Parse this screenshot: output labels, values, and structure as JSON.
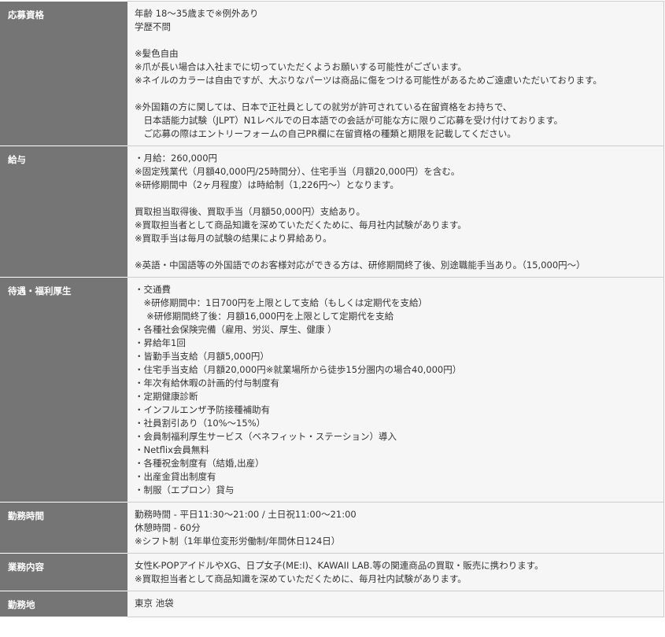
{
  "rows": [
    {
      "label": "応募資格",
      "lines": [
        "年齢 18～35歳まで※例外あり",
        "学歴不問",
        "",
        "※髪色自由",
        "※爪が長い場合は入社までに切っていただくようお願いする可能性がございます。",
        "※ネイルのカラーは自由ですが、大ぶりなパーツは商品に傷をつける可能性があるためご遠慮いただいております。",
        "",
        "※外国籍の方に関しては、日本で正社員としての就労が許可されている在留資格をお持ちで、",
        "　日本語能力試験（JLPT）N1レベルでの日本語での会話が可能な方に限りご応募を受け付けております。",
        "　ご応募の際はエントリーフォームの自己PR欄に在留資格の種類と期限を記載してください。"
      ]
    },
    {
      "label": "給与",
      "lines": [
        "・月給：260,000円",
        "※固定残業代（月額40,000円/25時間分）、住宅手当（月額20,000円）を含む。",
        "※研修期間中（2ヶ月程度）は時給制（1,226円～）となります。",
        "",
        "買取担当取得後、買取手当（月額50,000円）支給あり。",
        "※買取担当者として商品知識を深めていただくために、毎月社内試験があります。",
        "※買取手当は毎月の試験の結果により昇給あり。",
        "",
        "※英語・中国語等の外国語でのお客様対応ができる方は、研修期間終了後、別途職能手当あり。（15,000円～）"
      ]
    },
    {
      "label": "待遇・福利厚生",
      "lines": [
        "・交通費",
        "　※研修期間中：1日700円を上限として支給（もしくは定期代を支給）",
        "　 ※研修期間終了後：月額16,000円を上限として定期代を支給",
        "・各種社会保険完備（雇用、労災、厚生、健康 ）",
        "・昇給年1回",
        "・皆勤手当支給（月額5,000円）",
        "・住宅手当支給（月額20,000円※就業場所から徒歩15分圏内の場合40,000円）",
        "・年次有給休暇の計画的付与制度有",
        "・定期健康診断",
        "・インフルエンザ予防接種補助有",
        "・社員割引あり（10%～15%）",
        "・会員制福利厚生サービス（ベネフィット・ステーション）導入",
        "・Netflix会員無料",
        "・各種祝金制度有（結婚,出産）",
        "・出産金貸出制度有",
        "・制服（エプロン）貸与"
      ]
    },
    {
      "label": "勤務時間",
      "lines": [
        "勤務時間 - 平日11:30～21:00 / 土日祝11:00～21:00",
        "休憩時間 - 60分",
        "※シフト制（1年単位変形労働制/年間休日124日）"
      ]
    },
    {
      "label": "業務内容",
      "lines": [
        "女性K-POPアイドルやXG、日プ女子(ME:I)、KAWAII LAB.等の関連商品の買取・販売に携わります。",
        "※買取担当者として商品知識を深めていただくために、毎月社内試験があります。"
      ]
    },
    {
      "label": "勤務地",
      "lines": [
        "東京 池袋"
      ]
    }
  ]
}
